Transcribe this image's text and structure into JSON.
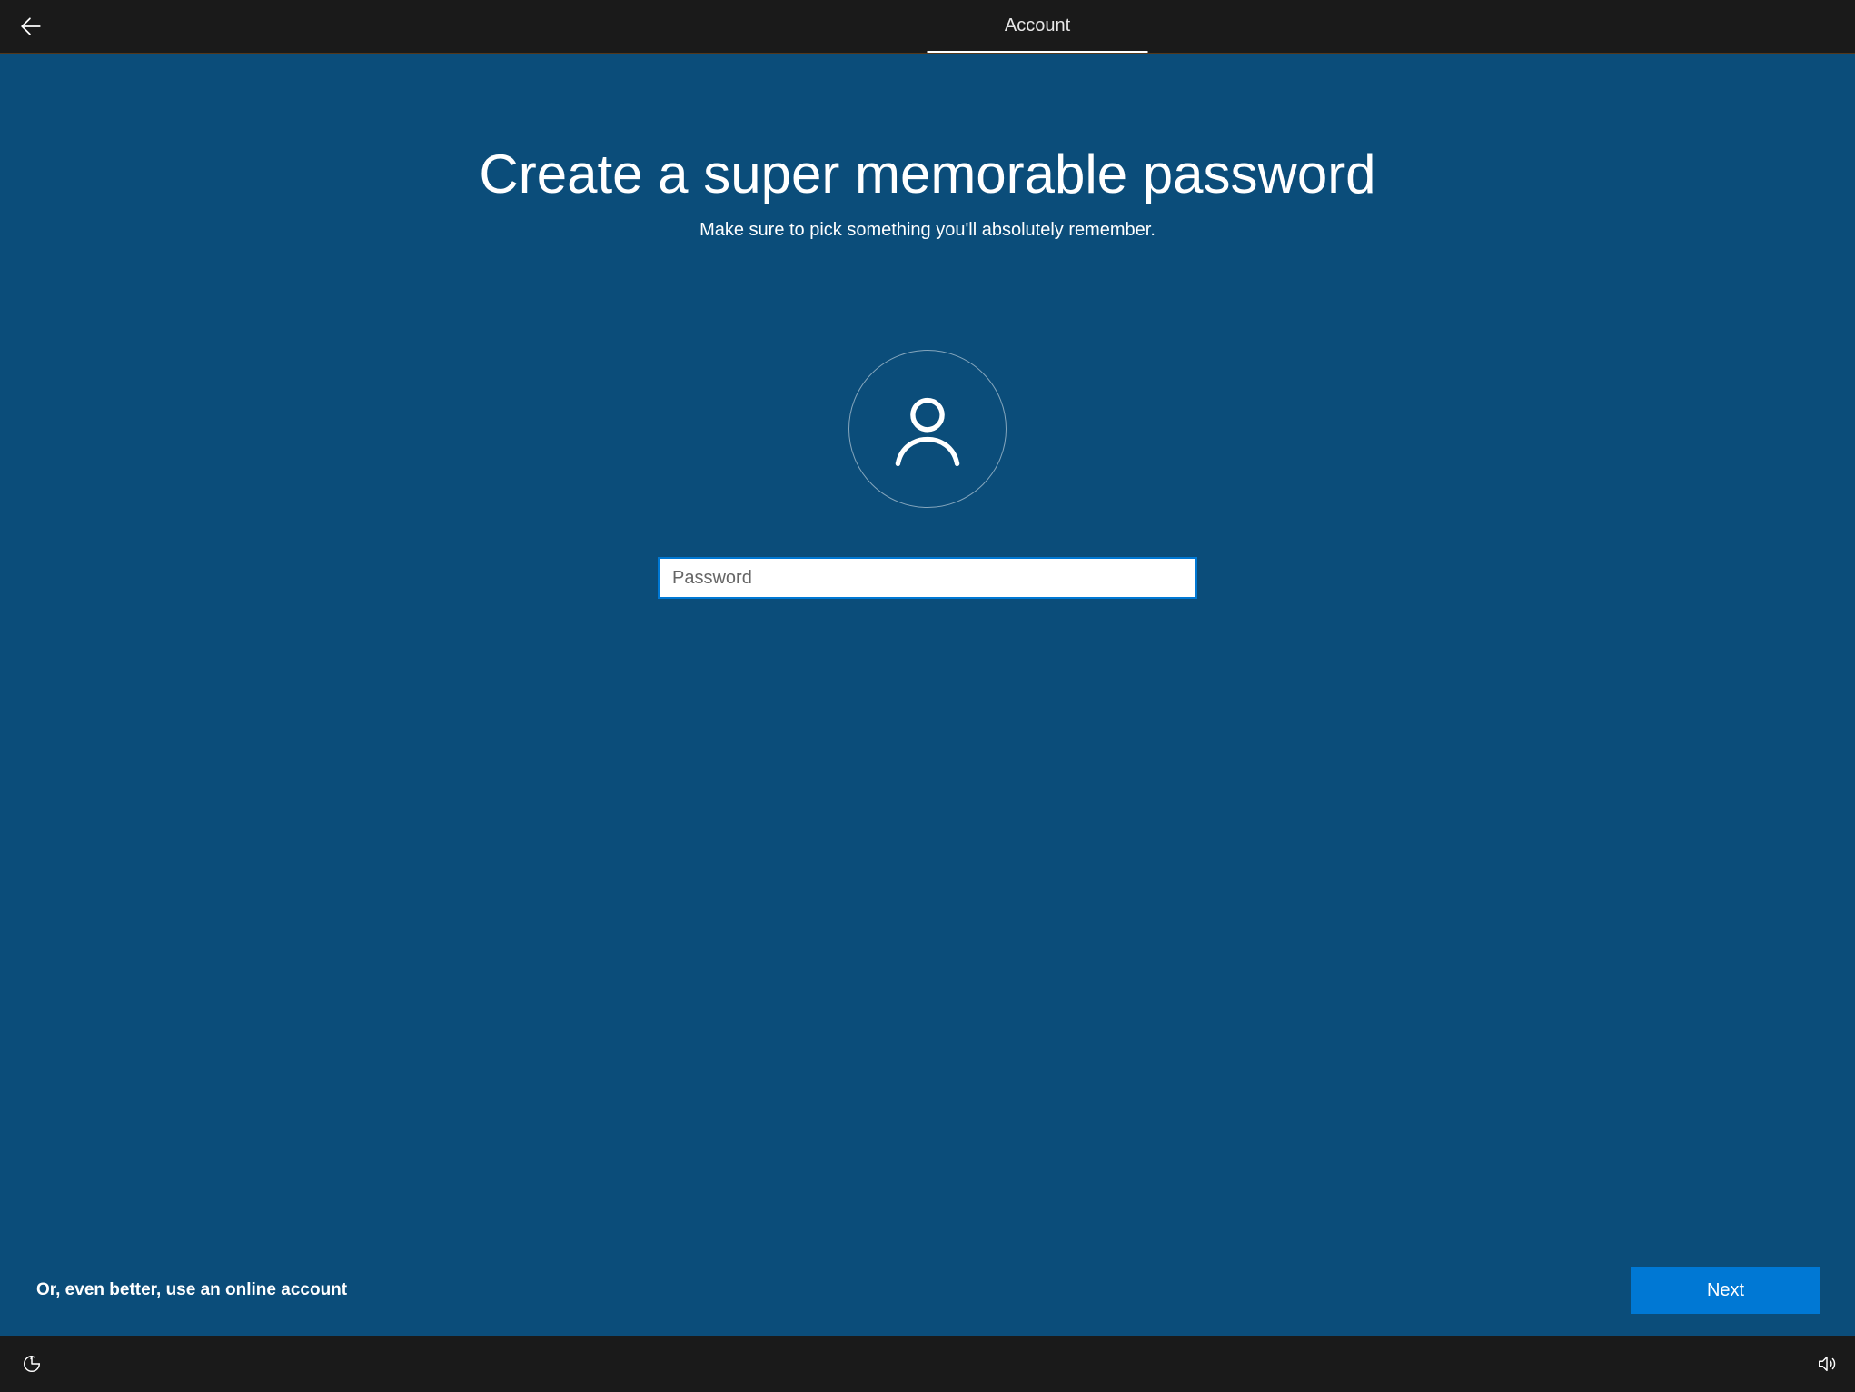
{
  "header": {
    "tab_label": "Account"
  },
  "main": {
    "title": "Create a super memorable password",
    "subtitle": "Make sure to pick something you'll absolutely remember.",
    "password_placeholder": "Password",
    "password_value": "",
    "online_account_link": "Or, even better, use an online account",
    "next_label": "Next"
  },
  "colors": {
    "background": "#0b4d7a",
    "header_bg": "#1a1a1a",
    "accent": "#0078d4"
  }
}
